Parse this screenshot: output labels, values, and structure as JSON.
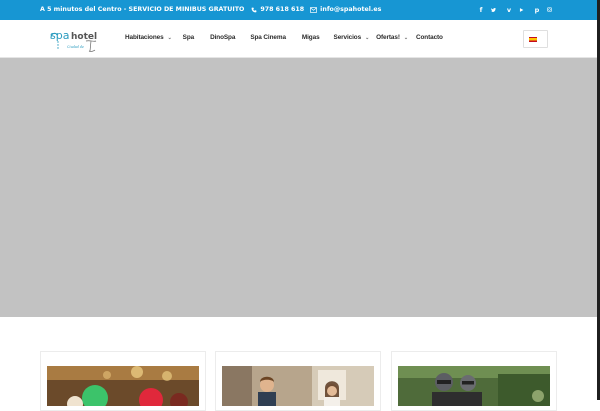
{
  "topbar": {
    "promo": "A 5 minutos del Centro - SERVICIO DE MINIBUS GRATUITO",
    "phone": "978 618 618",
    "email": "info@spahotel.es",
    "social": [
      "facebook",
      "twitter",
      "vimeo",
      "youtube",
      "pinterest",
      "instagram"
    ]
  },
  "logo": {
    "word1": "spa",
    "word2": "hotel",
    "tagline": "Ciudad de"
  },
  "nav": {
    "items": [
      {
        "label": "Habitaciones",
        "has_dropdown": true
      },
      {
        "label": "Spa",
        "has_dropdown": false
      },
      {
        "label": "DinoSpa",
        "has_dropdown": false
      },
      {
        "label": "Spa Cinema",
        "has_dropdown": false
      },
      {
        "label": "Migas",
        "has_dropdown": false
      },
      {
        "label": "Servicios",
        "has_dropdown": true
      },
      {
        "label": "Ofertas!",
        "has_dropdown": true
      },
      {
        "label": "Contacto",
        "has_dropdown": false
      }
    ],
    "language": "es"
  },
  "colors": {
    "topbar": "#1796d3",
    "slider_placeholder": "#c2c2c2",
    "logo_brand": "#2a9bbf"
  }
}
